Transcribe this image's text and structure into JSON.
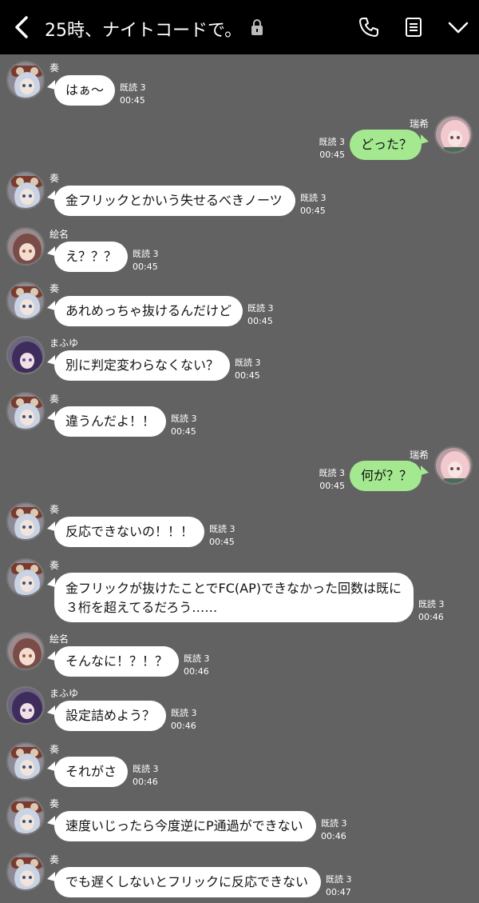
{
  "header": {
    "back_icon": "chevron-left-icon",
    "title": "25時、ナイトコードで。",
    "lock_icon": "lock-icon",
    "call_icon": "phone-icon",
    "notes_icon": "notes-icon",
    "menu_icon": "chevron-down-icon"
  },
  "colors": {
    "header_bg": "#000000",
    "chat_bg": "#626262",
    "incoming_bubble": "#ffffff",
    "outgoing_bubble": "#a4e98f"
  },
  "messages": [
    {
      "sender": "奏",
      "text": "はぁ〜",
      "read": "既読 3",
      "time": "00:45"
    },
    {
      "sender": "瑞希",
      "text": "どった？",
      "read": "既読 3",
      "time": "00:45"
    },
    {
      "sender": "奏",
      "text": "金フリックとかいう失せるべきノーツ",
      "read": "既読 3",
      "time": "00:45"
    },
    {
      "sender": "絵名",
      "text": "え？？？",
      "read": "既読 3",
      "time": "00:45"
    },
    {
      "sender": "奏",
      "text": "あれめっちゃ抜けるんだけど",
      "read": "既読 3",
      "time": "00:45"
    },
    {
      "sender": "まふゆ",
      "text": "別に判定変わらなくない？",
      "read": "既読 3",
      "time": "00:45"
    },
    {
      "sender": "奏",
      "text": "違うんだよ！！",
      "read": "既読 3",
      "time": "00:45"
    },
    {
      "sender": "瑞希",
      "text": "何が？？",
      "read": "既読 3",
      "time": "00:45"
    },
    {
      "sender": "奏",
      "text": "反応できないの！！！",
      "read": "既読 3",
      "time": "00:45"
    },
    {
      "sender": "奏",
      "text": "金フリックが抜けたことでFC(AP)できなかった回数は既に３桁を超えてるだろう……",
      "read": "既読 3",
      "time": "00:46"
    },
    {
      "sender": "絵名",
      "text": "そんなに！？！？",
      "read": "既読 3",
      "time": "00:46"
    },
    {
      "sender": "まふゆ",
      "text": "設定詰めよう？",
      "read": "既読 3",
      "time": "00:46"
    },
    {
      "sender": "奏",
      "text": "それがさ",
      "read": "既読 3",
      "time": "00:46"
    },
    {
      "sender": "奏",
      "text": "速度いじったら今度逆にP通過ができない",
      "read": "既読 3",
      "time": "00:46"
    },
    {
      "sender": "奏",
      "text": "でも遅くしないとフリックに反応できない",
      "read": "既読 3",
      "time": "00:47"
    }
  ]
}
